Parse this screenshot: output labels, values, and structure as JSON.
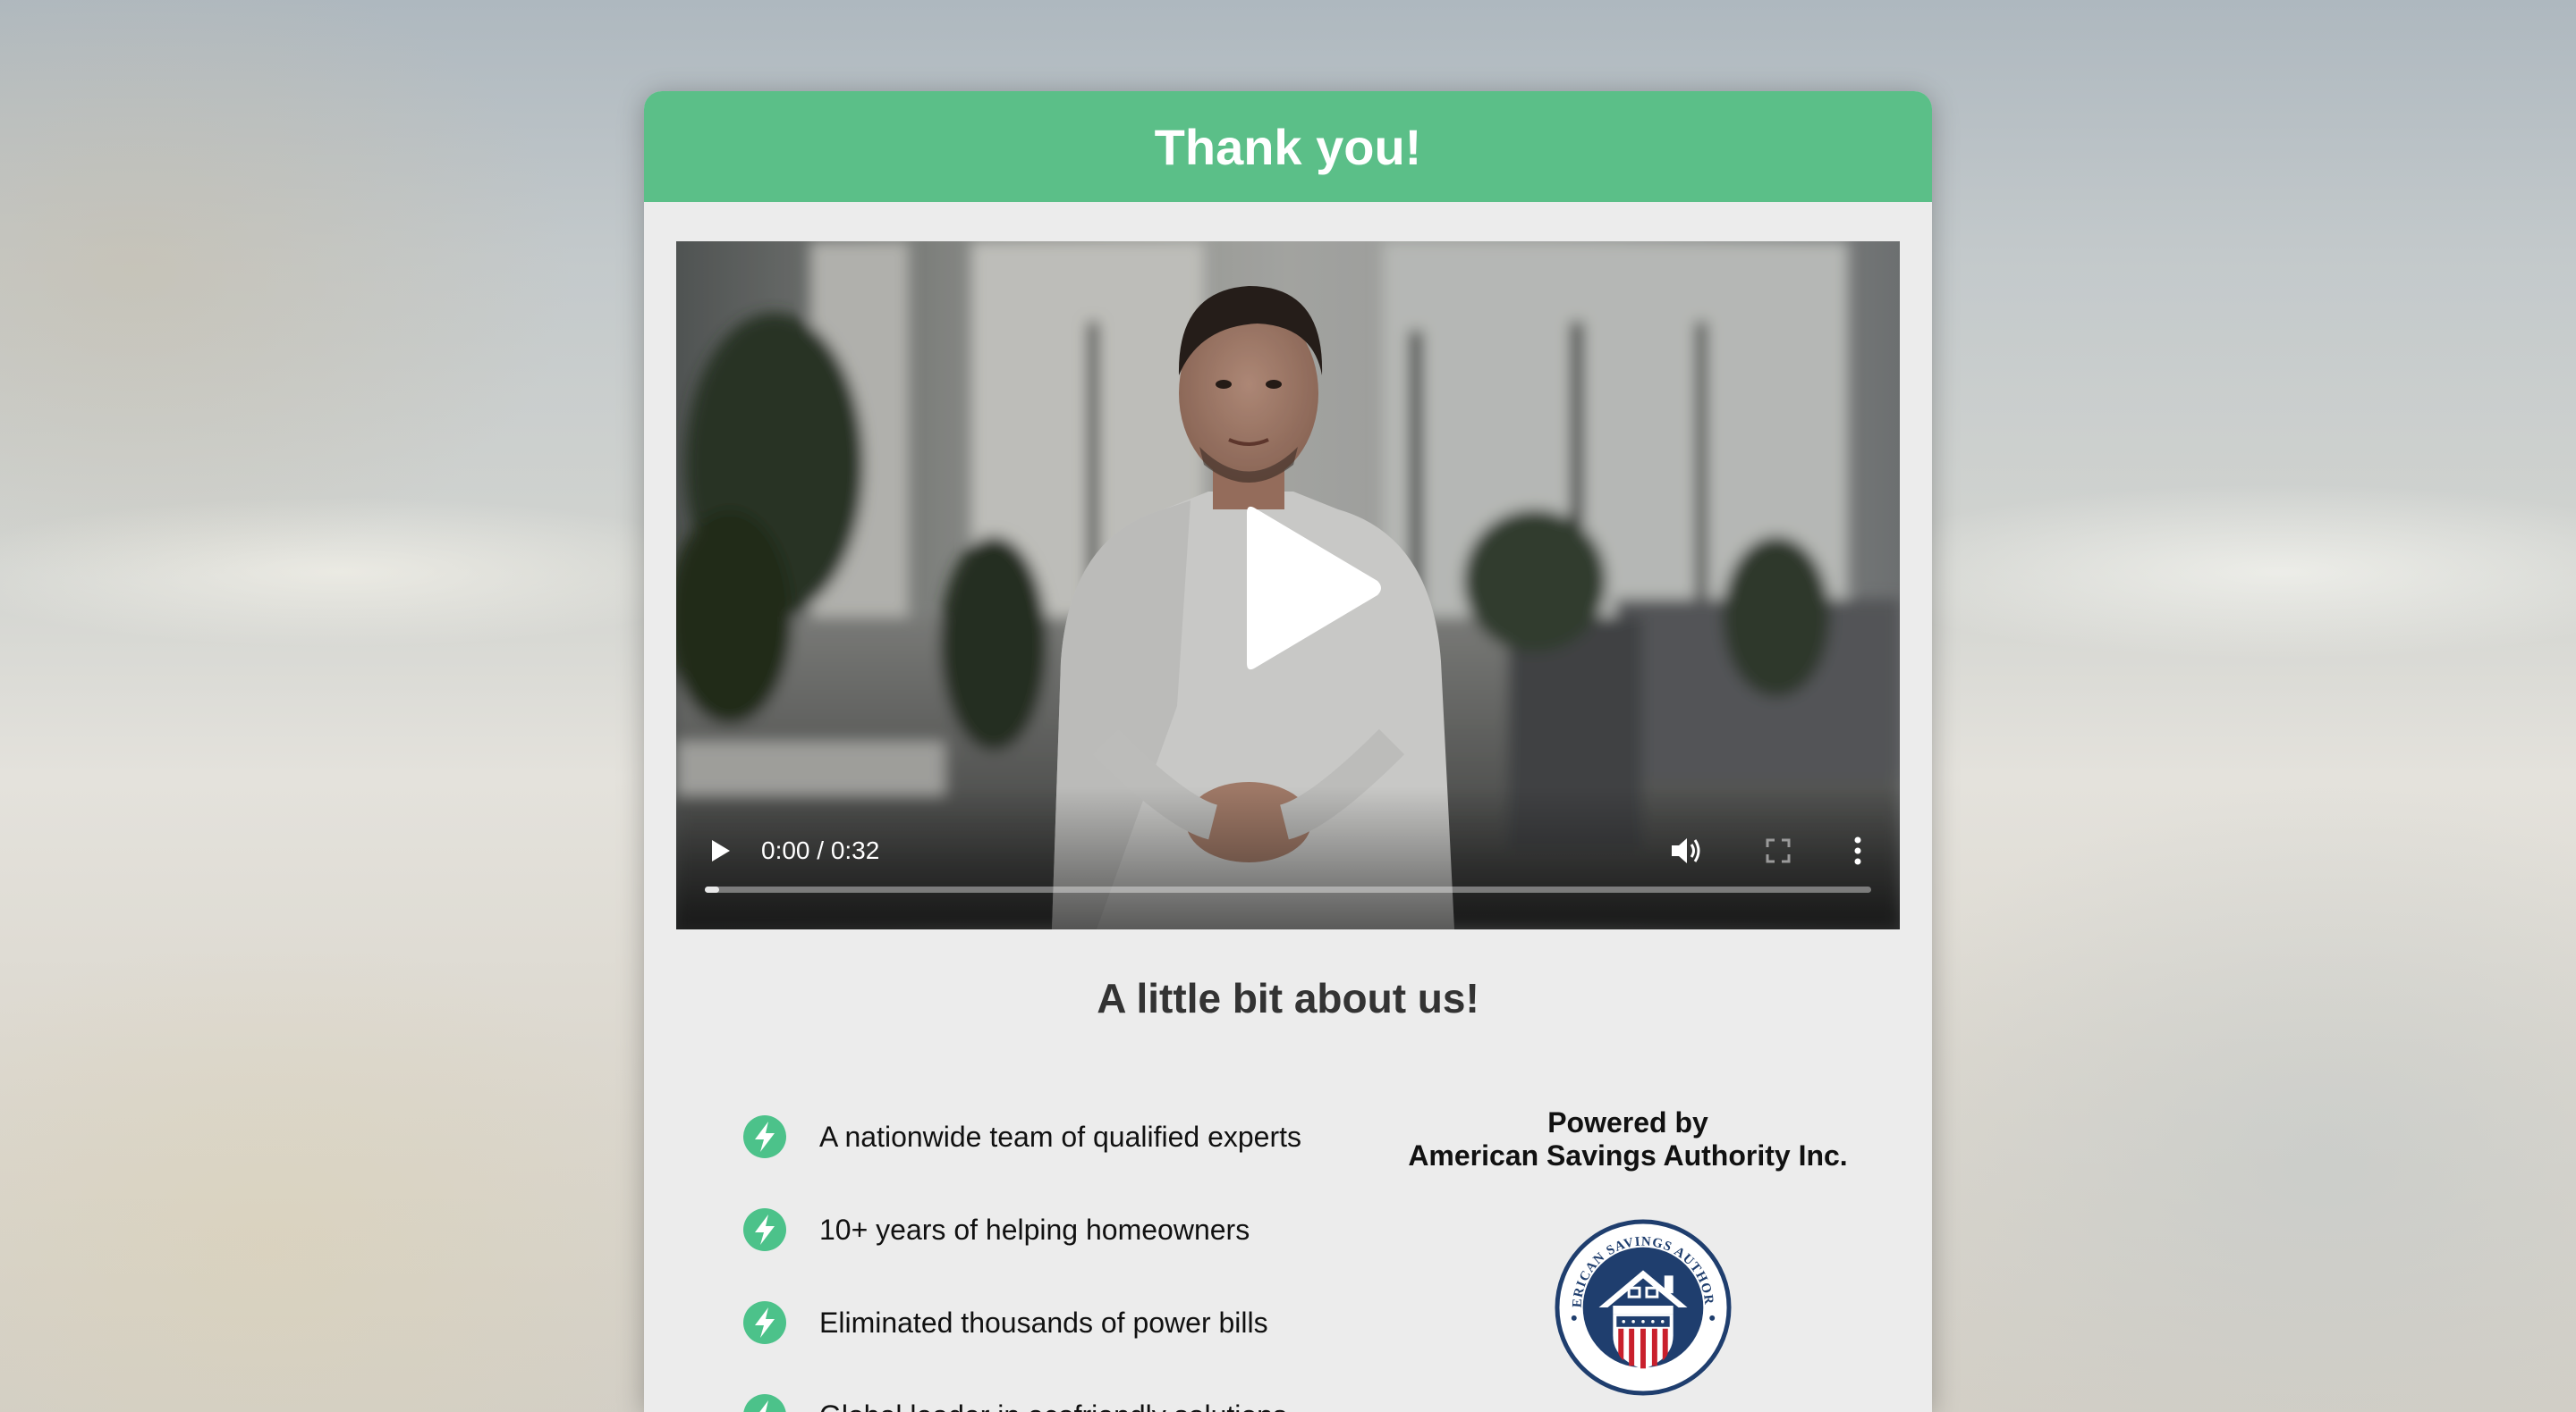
{
  "header": {
    "title": "Thank you!"
  },
  "video": {
    "current_time": "0:00",
    "duration": "0:32",
    "time_display": "0:00 / 0:32",
    "progress_fraction": 0.0,
    "icons": [
      "play-large-icon",
      "play-icon",
      "volume-icon",
      "fullscreen-icon",
      "more-options-icon"
    ]
  },
  "about": {
    "title": "A little bit about us!",
    "items": [
      {
        "text": "A nationwide team of qualified experts",
        "icon": "lightning-icon"
      },
      {
        "text": "10+ years of helping homeowners",
        "icon": "lightning-icon"
      },
      {
        "text": "Eliminated thousands of power bills",
        "icon": "lightning-icon"
      },
      {
        "text": "Global leader in ecofriendly solutions",
        "icon": "lightning-icon"
      }
    ]
  },
  "powered": {
    "line1": "Powered by",
    "line2": "American Savings Authority Inc.",
    "seal_text": "AMERICAN SAVINGS AUTHORITY"
  },
  "colors": {
    "header_green": "#5bbf88",
    "card_bg": "#ececec",
    "icon_green": "#4cc28a",
    "seal_navy": "#1f3e6e",
    "seal_red": "#c9202c"
  }
}
